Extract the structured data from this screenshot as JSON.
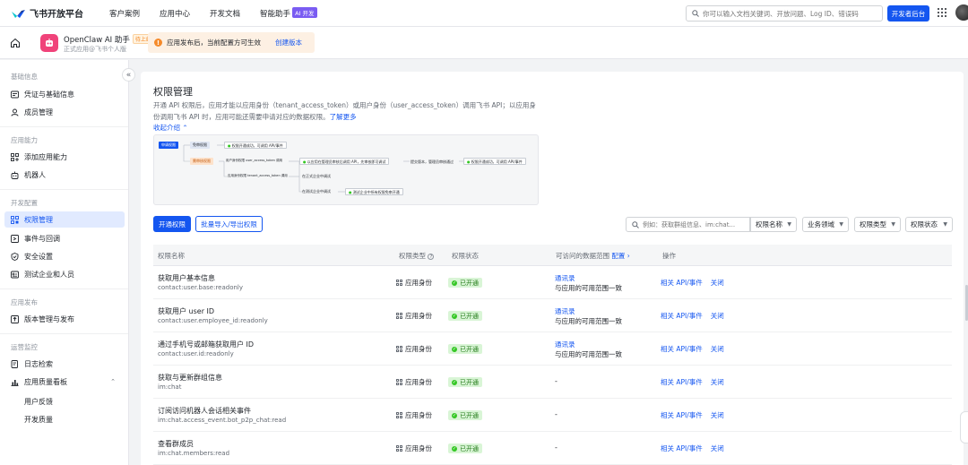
{
  "brand": {
    "name": "飞书开放平台"
  },
  "topnav": {
    "items": [
      "客户案例",
      "应用中心",
      "开发文档",
      "智能助手"
    ],
    "ai_badge": "AI 开发",
    "search_placeholder": "你可以输入文档关键词、开放问题、Log ID、错误码",
    "dev_console": "开发者后台"
  },
  "app": {
    "name": "OpenClaw AI 助手",
    "status_badge": "待上线",
    "subtitle": "正式应用@飞书个人版",
    "notice_text": "应用发布后，当前配置方可生效",
    "notice_link": "创建版本"
  },
  "sidebar": {
    "groups": [
      {
        "title": "基础信息",
        "items": [
          "凭证与基础信息",
          "成员管理"
        ]
      },
      {
        "title": "应用能力",
        "items": [
          "添加应用能力",
          "机器人"
        ]
      },
      {
        "title": "开发配置",
        "items": [
          "权限管理",
          "事件与回调",
          "安全设置",
          "测试企业和人员"
        ]
      },
      {
        "title": "应用发布",
        "items": [
          "版本管理与发布"
        ]
      },
      {
        "title": "运营监控",
        "items": [
          "日志检索",
          "应用质量看板"
        ],
        "subitems": [
          "用户反馈",
          "开发质量"
        ]
      }
    ],
    "active": "权限管理"
  },
  "page": {
    "title": "权限管理",
    "desc_main": "开通 API 权限后，应用才能以应用身份（tenant_access_token）或用户身份（user_access_token）调用飞书 API；以应用身份调用飞书 API 时，应用可能还需要申请对应的数据权限。",
    "desc_link": "了解更多",
    "collapse": "收起介绍"
  },
  "flow": {
    "start": "申请权限",
    "auto": "免审权限",
    "auto_result": "权限开通成功，可调用 API/事件",
    "review": "需审核权限",
    "user_token": "用户身份权限 user_access_token 调用",
    "step_approve": "以应用在管理员审核后调用 API，先审核即可调试",
    "step_submit": "提交版本，管理员审核通过",
    "final": "权限开通成功，可调用 API/事件",
    "app_token": "应用身份权限 tenant_access_token 调用",
    "enterprise": "在正式企业中调试",
    "test_enterprise": "在测试企业中调试",
    "test_result": "测试企业中所有权限免审开通"
  },
  "toolbar": {
    "open_btn": "开通权限",
    "batch_btn": "批量导入/导出权限",
    "search_placeholder": "例如：获取群组信息、im:chat...",
    "filters": [
      "权限名称",
      "业务领域",
      "权限类型",
      "权限状态"
    ]
  },
  "table": {
    "headers": {
      "name": "权限名称",
      "type": "权限类型",
      "status": "权限状态",
      "range": "可访问的数据范围",
      "range_link": "配置",
      "ops": "操作"
    },
    "rows": [
      {
        "name": "获取用户基本信息",
        "scope": "contact:user.base:readonly",
        "type": "应用身份",
        "status": "已开通",
        "range_link": "通讯录",
        "range_text": "与应用的可用范围一致",
        "op1": "相关 API/事件",
        "op2": "关闭"
      },
      {
        "name": "获取用户 user ID",
        "scope": "contact:user.employee_id:readonly",
        "type": "应用身份",
        "status": "已开通",
        "range_link": "通讯录",
        "range_text": "与应用的可用范围一致",
        "op1": "相关 API/事件",
        "op2": "关闭"
      },
      {
        "name": "通过手机号或邮箱获取用户 ID",
        "scope": "contact:user.id:readonly",
        "type": "应用身份",
        "status": "已开通",
        "range_link": "通讯录",
        "range_text": "与应用的可用范围一致",
        "op1": "相关 API/事件",
        "op2": "关闭"
      },
      {
        "name": "获取与更新群组信息",
        "scope": "im:chat",
        "type": "应用身份",
        "status": "已开通",
        "range_dash": "-",
        "op1": "相关 API/事件",
        "op2": "关闭"
      },
      {
        "name": "订阅访问机器人会话相关事件",
        "scope": "im:chat.access_event.bot_p2p_chat:read",
        "type": "应用身份",
        "status": "已开通",
        "range_dash": "-",
        "op1": "相关 API/事件",
        "op2": "关闭"
      },
      {
        "name": "查看群成员",
        "scope": "im:chat.members:read",
        "type": "应用身份",
        "status": "已开通",
        "range_dash": "-",
        "op1": "相关 API/事件",
        "op2": "关闭"
      }
    ]
  },
  "colors": {
    "primary": "#1456f0",
    "success": "#34c724",
    "warning": "#f58a2b",
    "app_icon": "#f0437a"
  }
}
